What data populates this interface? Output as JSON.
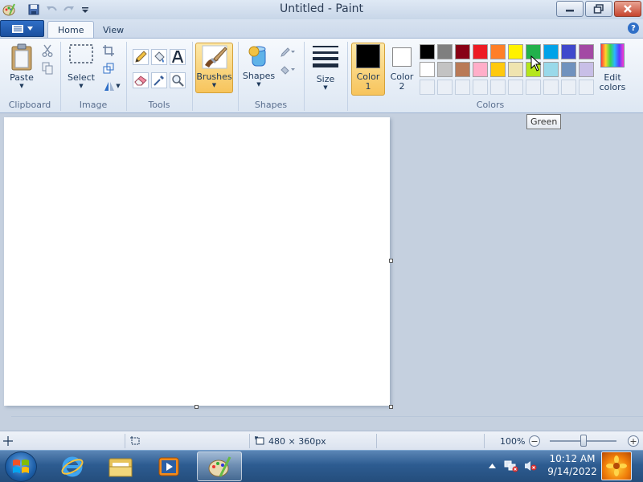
{
  "window": {
    "title": "Untitled - Paint"
  },
  "tabs": [
    {
      "label": "Home"
    },
    {
      "label": "View"
    }
  ],
  "ribbon": {
    "clipboard": {
      "label": "Clipboard",
      "paste": "Paste"
    },
    "image": {
      "label": "Image",
      "select": "Select"
    },
    "tools": {
      "label": "Tools"
    },
    "brushes": {
      "label": "Brushes"
    },
    "shapes": {
      "label": "Shapes",
      "shapes_btn": "Shapes"
    },
    "size": {
      "label": "Size"
    },
    "colors": {
      "label": "Colors",
      "color1_line1": "Color",
      "color1_line2": "1",
      "color2_line1": "Color",
      "color2_line2": "2",
      "edit_line1": "Edit",
      "edit_line2": "colors",
      "color1_value": "#000000",
      "color2_value": "#ffffff",
      "palette_row1": [
        "#000000",
        "#7f7f7f",
        "#880015",
        "#ed1c24",
        "#ff7f27",
        "#fff200",
        "#22b14c",
        "#00a2e8",
        "#3f48cc",
        "#a349a4"
      ],
      "palette_row2": [
        "#ffffff",
        "#c3c3c3",
        "#b97a57",
        "#ffaec9",
        "#ffc90e",
        "#efe4b0",
        "#b5e61d",
        "#99d9ea",
        "#7092be",
        "#c8bfe7"
      ]
    }
  },
  "tooltip": {
    "text": "Green"
  },
  "status": {
    "image_size": "480 × 360px",
    "zoom": "100%",
    "zoom_minus": "−",
    "zoom_plus": "+"
  },
  "clock": {
    "time": "10:12 AM",
    "date": "9/14/2022"
  }
}
